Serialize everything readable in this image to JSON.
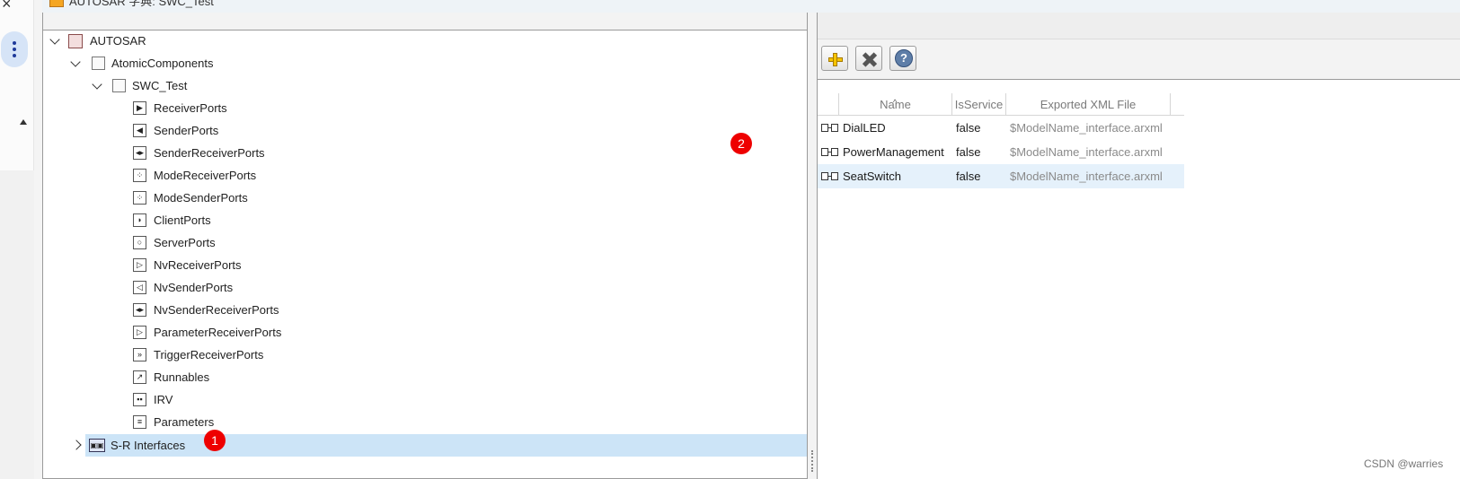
{
  "window": {
    "title": "AUTOSAR 字典: SWC_Test"
  },
  "tree": {
    "root": {
      "label": "AUTOSAR"
    },
    "atomic": {
      "label": "AtomicComponents"
    },
    "component": {
      "label": "SWC_Test"
    },
    "items": [
      {
        "label": "ReceiverPorts",
        "icon": "receiver-port-icon",
        "glyph": "▶"
      },
      {
        "label": "SenderPorts",
        "icon": "sender-port-icon",
        "glyph": "◀"
      },
      {
        "label": "SenderReceiverPorts",
        "icon": "sender-receiver-port-icon",
        "glyph": "◂▸"
      },
      {
        "label": "ModeReceiverPorts",
        "icon": "mode-receiver-port-icon",
        "glyph": "⁘"
      },
      {
        "label": "ModeSenderPorts",
        "icon": "mode-sender-port-icon",
        "glyph": "⁘"
      },
      {
        "label": "ClientPorts",
        "icon": "client-port-icon",
        "glyph": "◗"
      },
      {
        "label": "ServerPorts",
        "icon": "server-port-icon",
        "glyph": "○"
      },
      {
        "label": "NvReceiverPorts",
        "icon": "nv-receiver-port-icon",
        "glyph": "▷"
      },
      {
        "label": "NvSenderPorts",
        "icon": "nv-sender-port-icon",
        "glyph": "◁"
      },
      {
        "label": "NvSenderReceiverPorts",
        "icon": "nv-sender-receiver-port-icon",
        "glyph": "◂▸"
      },
      {
        "label": "ParameterReceiverPorts",
        "icon": "parameter-receiver-port-icon",
        "glyph": "▷"
      },
      {
        "label": "TriggerReceiverPorts",
        "icon": "trigger-receiver-port-icon",
        "glyph": "»"
      },
      {
        "label": "Runnables",
        "icon": "runnables-icon",
        "glyph": "↗"
      },
      {
        "label": "IRV",
        "icon": "irv-icon",
        "glyph": "▪▪"
      },
      {
        "label": "Parameters",
        "icon": "parameters-icon",
        "glyph": "≡"
      }
    ],
    "sr_interfaces": {
      "label": "S-R Interfaces"
    }
  },
  "table": {
    "columns": [
      "Name",
      "IsService",
      "Exported XML File"
    ],
    "rows": [
      {
        "name": "DialLED",
        "is_service": "false",
        "file": "$ModelName_interface.arxml"
      },
      {
        "name": "PowerManagement",
        "is_service": "false",
        "file": "$ModelName_interface.arxml"
      },
      {
        "name": "SeatSwitch",
        "is_service": "false",
        "file": "$ModelName_interface.arxml"
      }
    ]
  },
  "badges": {
    "one": "1",
    "two": "2"
  },
  "watermark": "CSDN @warries",
  "colors": {
    "selection": "#cce4f7",
    "row_selection": "#e5f1fb",
    "badge": "#ee0000"
  }
}
